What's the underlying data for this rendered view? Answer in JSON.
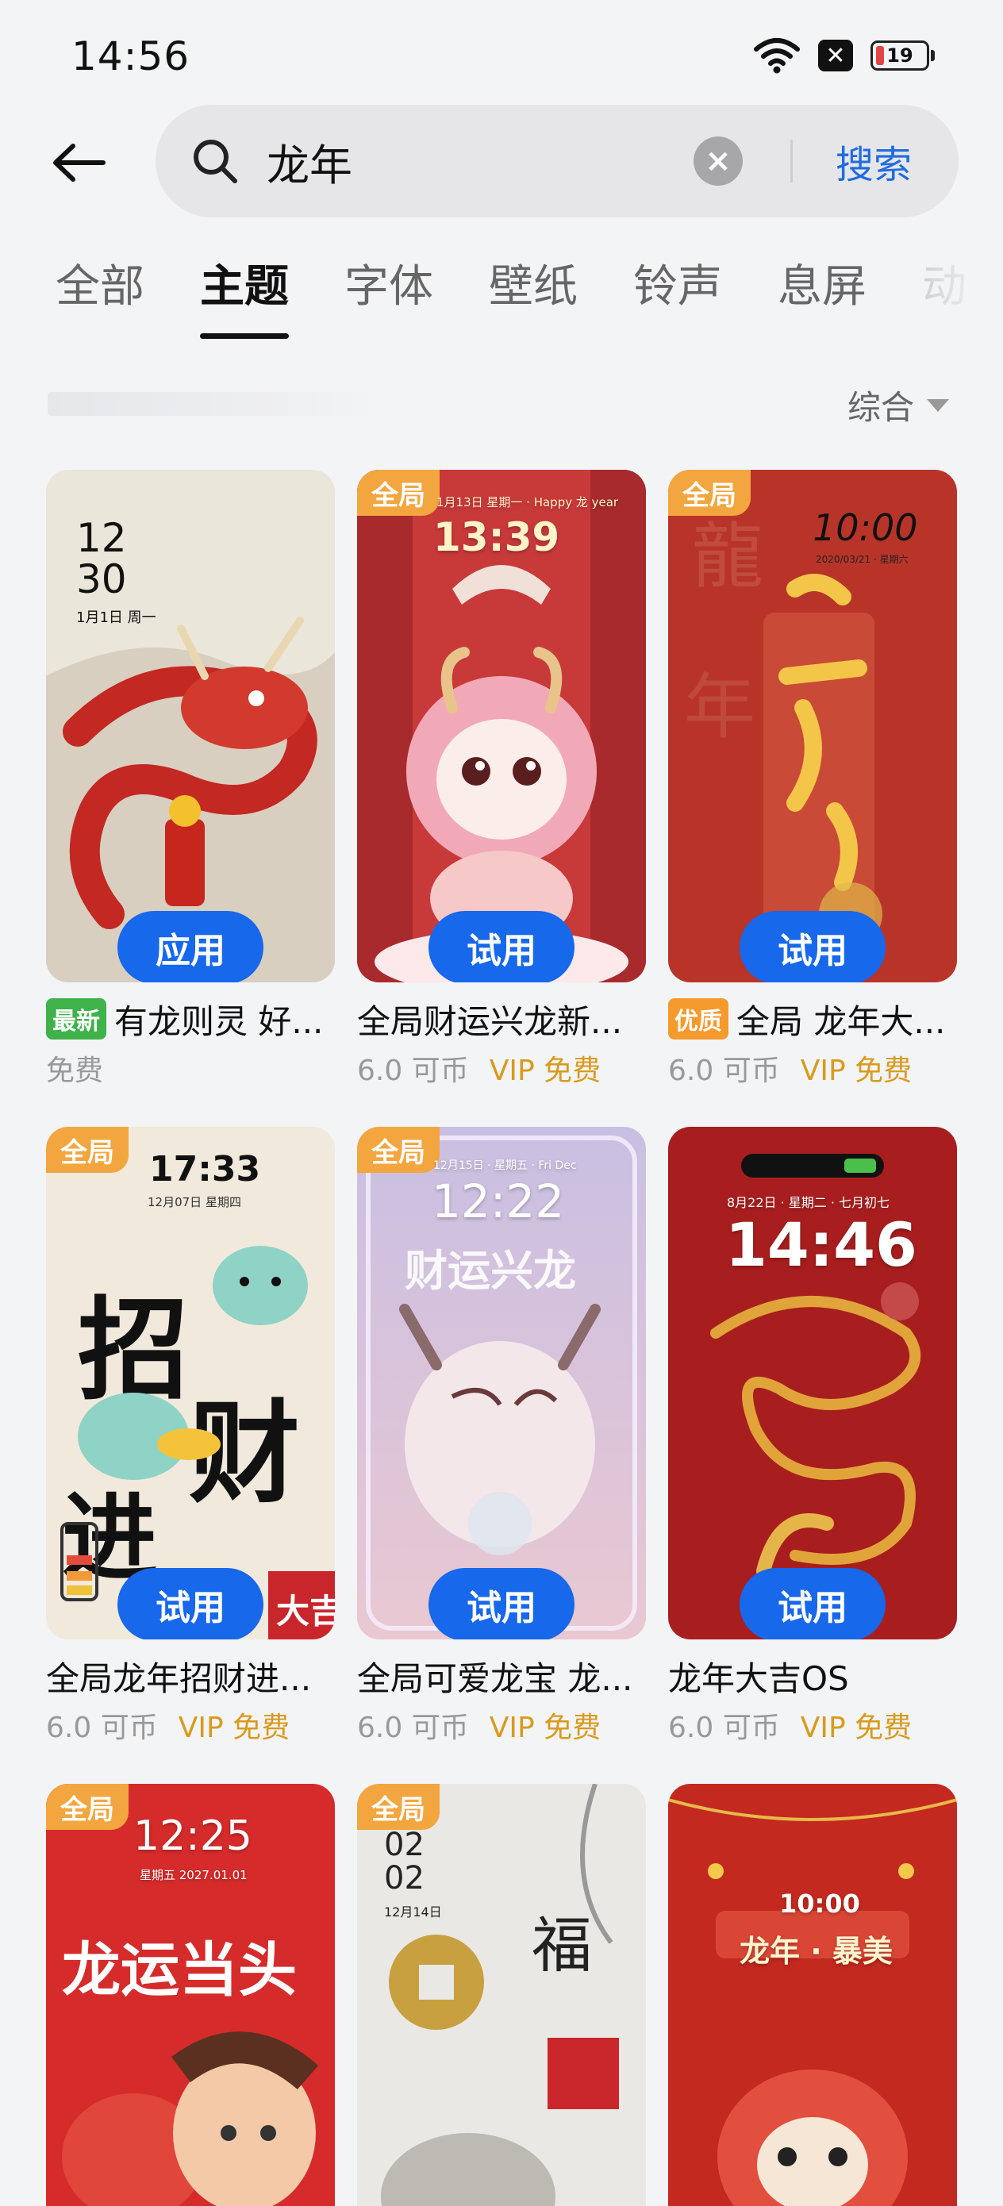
{
  "status": {
    "time": "14:56",
    "battery": "19"
  },
  "search": {
    "query": "龙年",
    "submit_label": "搜索"
  },
  "tabs": [
    {
      "label": "全部"
    },
    {
      "label": "主题"
    },
    {
      "label": "字体"
    },
    {
      "label": "壁纸"
    },
    {
      "label": "铃声"
    },
    {
      "label": "息屏"
    },
    {
      "label": "动"
    }
  ],
  "active_tab": "主题",
  "sort": {
    "label": "综合"
  },
  "cards": [
    {
      "title": "有龙则灵 好...",
      "tag": "最新",
      "price": "免费",
      "vip": "",
      "action": "应用",
      "badge": "",
      "thumb_time": "12\n30",
      "thumb_sub": "1月1日 周一",
      "bg": "#e9e4d8"
    },
    {
      "title": "全局财运兴龙新...",
      "tag": "",
      "price": "6.0 可币",
      "vip": "VIP 免费",
      "action": "试用",
      "badge": "全局",
      "thumb_time": "13:39",
      "thumb_sub": "1月13日 星期一 · Happy 龙 year",
      "bg": "#c83b3b"
    },
    {
      "title": "全局 龙年大...",
      "tag": "优质",
      "price": "6.0 可币",
      "vip": "VIP 免费",
      "action": "试用",
      "badge": "全局",
      "thumb_time": "10:00",
      "thumb_sub": "2020/03/21 · 星期六",
      "bg": "#b83429"
    },
    {
      "title": "全局龙年招财进...",
      "tag": "",
      "price": "6.0 可币",
      "vip": "VIP 免费",
      "action": "试用",
      "badge": "全局",
      "thumb_time": "17:33",
      "thumb_sub": "12月07日 星期四",
      "bg": "#f1e9dc"
    },
    {
      "title": "全局可爱龙宝 龙...",
      "tag": "",
      "price": "6.0 可币",
      "vip": "VIP 免费",
      "action": "试用",
      "badge": "全局",
      "thumb_time": "12:22",
      "thumb_sub": "12月15日 · 星期五 · Fri Dec",
      "bg": "#cfc4dc"
    },
    {
      "title": "龙年大吉OS",
      "tag": "",
      "price": "6.0 可币",
      "vip": "VIP 免费",
      "action": "试用",
      "badge": "",
      "thumb_time": "14:46",
      "thumb_sub": "8月22日 · 星期二 · 七月初七",
      "bg": "#a81e1e"
    },
    {
      "title": "",
      "tag": "",
      "price": "",
      "vip": "",
      "action": "",
      "badge": "全局",
      "thumb_time": "12:25",
      "thumb_sub": "星期五 2027.01.01",
      "bg": "#d62b2b"
    },
    {
      "title": "",
      "tag": "",
      "price": "",
      "vip": "",
      "action": "",
      "badge": "全局",
      "thumb_time": "02\n02",
      "thumb_sub": "12月14日",
      "bg": "#e9e8e4"
    },
    {
      "title": "",
      "tag": "",
      "price": "",
      "vip": "",
      "action": "",
      "badge": "",
      "thumb_time": "10:00",
      "thumb_sub": "龙年 · 暴美",
      "bg": "#c3291f"
    }
  ]
}
